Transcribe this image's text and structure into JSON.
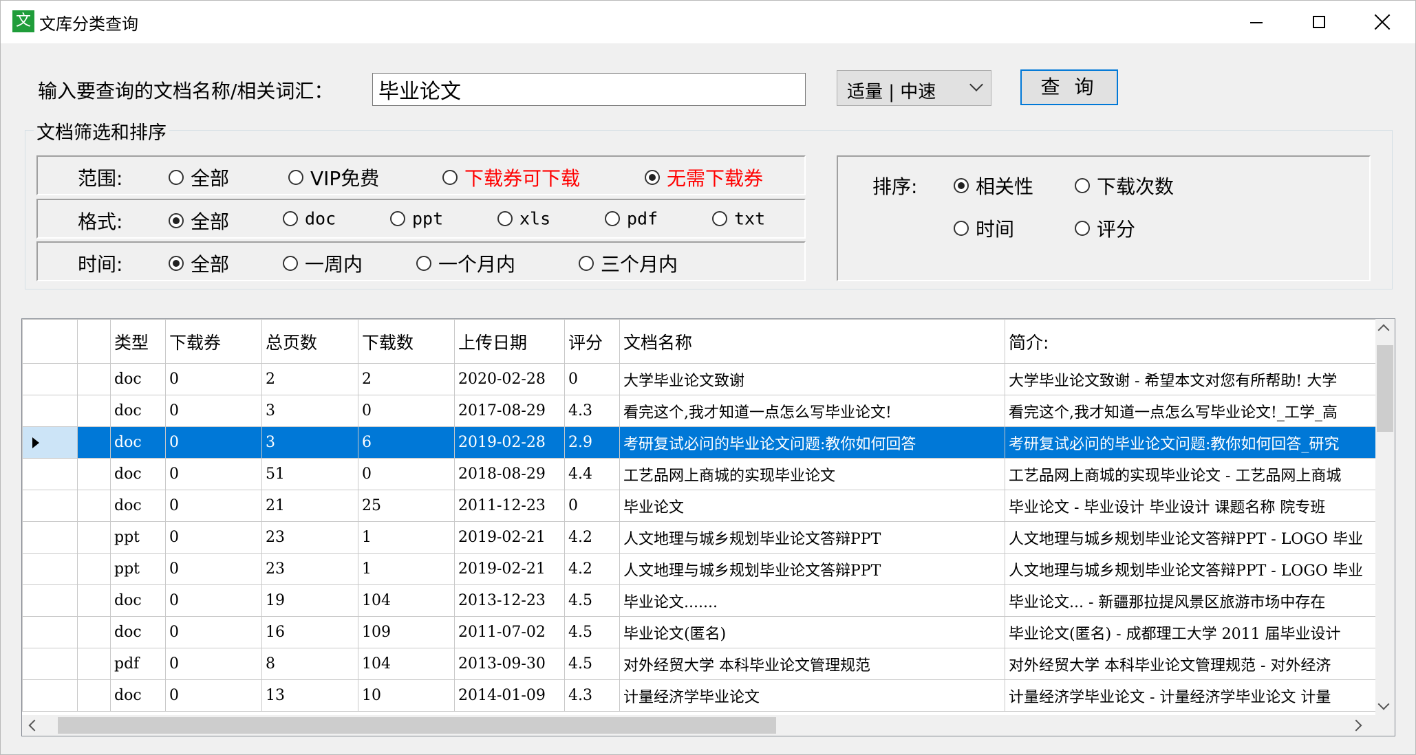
{
  "window": {
    "title": "文库分类查询",
    "icon_char": "文",
    "icon_color": "#1f9d3a",
    "controls": [
      "minimize-icon",
      "maximize-icon",
      "close-icon"
    ]
  },
  "search": {
    "prompt_label": "输入要查询的文档名称/相关词汇：",
    "input_value": "毕业论文",
    "mode_value": "适量 | 中速",
    "query_button": "查 询"
  },
  "filters": {
    "group_title": "文档筛选和排序",
    "scope": {
      "label": "范围:",
      "options": [
        "全部",
        "VIP免费",
        "下载券可下载",
        "无需下载券"
      ],
      "selected": 3
    },
    "format": {
      "label": "格式:",
      "options": [
        "全部",
        "doc",
        "ppt",
        "xls",
        "pdf",
        "txt"
      ],
      "selected": 0
    },
    "time": {
      "label": "时间:",
      "options": [
        "全部",
        "一周内",
        "一个月内",
        "三个月内"
      ],
      "selected": 0
    },
    "sort": {
      "label": "排序:",
      "options": [
        "相关性",
        "下载次数",
        "时间",
        "评分"
      ],
      "selected": 0
    },
    "highlight_color": "#ff0000"
  },
  "table": {
    "columns": [
      "",
      "类型",
      "下载券",
      "总页数",
      "下载数",
      "上传日期",
      "评分",
      "文档名称",
      "简介:"
    ],
    "selected_row": 2,
    "selection_color": "#0078d7",
    "rows": [
      [
        "doc",
        "0",
        "2",
        "2",
        "2020-02-28",
        "0",
        "大学毕业论文致谢",
        "大学毕业论文致谢 - 希望本文对您有所帮助! 大学"
      ],
      [
        "doc",
        "0",
        "3",
        "0",
        "2017-08-29",
        "4.3",
        "看完这个,我才知道一点怎么写毕业论文!",
        "看完这个,我才知道一点怎么写毕业论文!_工学_高"
      ],
      [
        "doc",
        "0",
        "3",
        "6",
        "2019-02-28",
        "2.9",
        "考研复试必问的毕业论文问题:教你如何回答",
        "考研复试必问的毕业论文问题:教你如何回答_研究"
      ],
      [
        "doc",
        "0",
        "51",
        "0",
        "2018-08-29",
        "4.4",
        "工艺品网上商城的实现毕业论文",
        "工艺品网上商城的实现毕业论文 - 工艺品网上商城"
      ],
      [
        "doc",
        "0",
        "21",
        "25",
        "2011-12-23",
        "0",
        "毕业论文",
        "毕业论文 - 毕业设计 毕业设计 课题名称 院专班"
      ],
      [
        "ppt",
        "0",
        "23",
        "1",
        "2019-02-21",
        "4.2",
        "人文地理与城乡规划毕业论文答辩PPT",
        "人文地理与城乡规划毕业论文答辩PPT - LOGO 毕业"
      ],
      [
        "ppt",
        "0",
        "23",
        "1",
        "2019-02-21",
        "4.2",
        "人文地理与城乡规划毕业论文答辩PPT",
        "人文地理与城乡规划毕业论文答辩PPT - LOGO 毕业"
      ],
      [
        "doc",
        "0",
        "19",
        "104",
        "2013-12-23",
        "4.5",
        "毕业论文.......",
        "毕业论文... - 新疆那拉提风景区旅游市场中存在"
      ],
      [
        "doc",
        "0",
        "16",
        "109",
        "2011-07-02",
        "4.5",
        "毕业论文(匿名)",
        "毕业论文(匿名) - 成都理工大学 2011 届毕业设计"
      ],
      [
        "pdf",
        "0",
        "8",
        "104",
        "2013-09-30",
        "4.5",
        "对外经贸大学 本科毕业论文管理规范",
        "对外经贸大学 本科毕业论文管理规范 - 对外经济"
      ],
      [
        "doc",
        "0",
        "13",
        "10",
        "2014-01-09",
        "4.3",
        "计量经济学毕业论文",
        "计量经济学毕业论文 - 计量经济学毕业论文 计量"
      ]
    ]
  }
}
